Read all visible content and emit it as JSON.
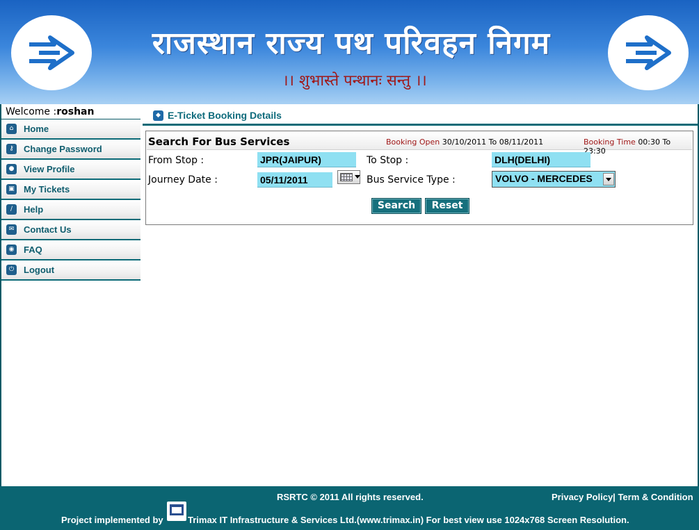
{
  "header": {
    "org_name": "राजस्थान राज्य पथ परिवहन निगम",
    "tagline": "।। शुभास्ते पन्थानः सन्तु ।।"
  },
  "sidebar": {
    "welcome_prefix": "Welcome :",
    "username": "roshan",
    "items": [
      {
        "label": "Home",
        "icon": "home-icon"
      },
      {
        "label": "Change Password",
        "icon": "key-icon"
      },
      {
        "label": "View Profile",
        "icon": "user-icon"
      },
      {
        "label": "My Tickets",
        "icon": "ticket-icon"
      },
      {
        "label": "Help",
        "icon": "help-icon"
      },
      {
        "label": "Contact Us",
        "icon": "mail-icon"
      },
      {
        "label": "FAQ",
        "icon": "chat-icon"
      },
      {
        "label": "Logout",
        "icon": "power-icon"
      }
    ]
  },
  "main": {
    "heading": "E-Ticket Booking Details",
    "panel": {
      "title": "Search For Bus Services",
      "booking_open_label": "Booking Open",
      "booking_open_range": "30/10/2011 To 08/11/2011",
      "booking_time_label": "Booking Time",
      "booking_time_range": "00:30 To 23:30"
    },
    "form": {
      "from_label": "From Stop :",
      "from_value": "JPR(JAIPUR)",
      "to_label": "To Stop :",
      "to_value": "DLH(DELHI)",
      "date_label": "Journey Date :",
      "date_value": "05/11/2011",
      "service_label": "Bus Service Type :",
      "service_value": "VOLVO - MERCEDES",
      "search_btn": "Search",
      "reset_btn": "Reset"
    }
  },
  "footer": {
    "copyright": "RSRTC © 2011 All rights reserved.",
    "privacy": "Privacy Policy",
    "separator": "|",
    "terms": "Term & Condition",
    "project_prefix": "Project implemented by",
    "vendor_text": "Trimax IT Infrastructure & Services Ltd.(www.trimax.in) For best view use 1024x768 Screen Resolution."
  },
  "colors": {
    "teal": "#0b6572",
    "field_bg": "#8fe0f2",
    "accent_red": "#a01818"
  }
}
